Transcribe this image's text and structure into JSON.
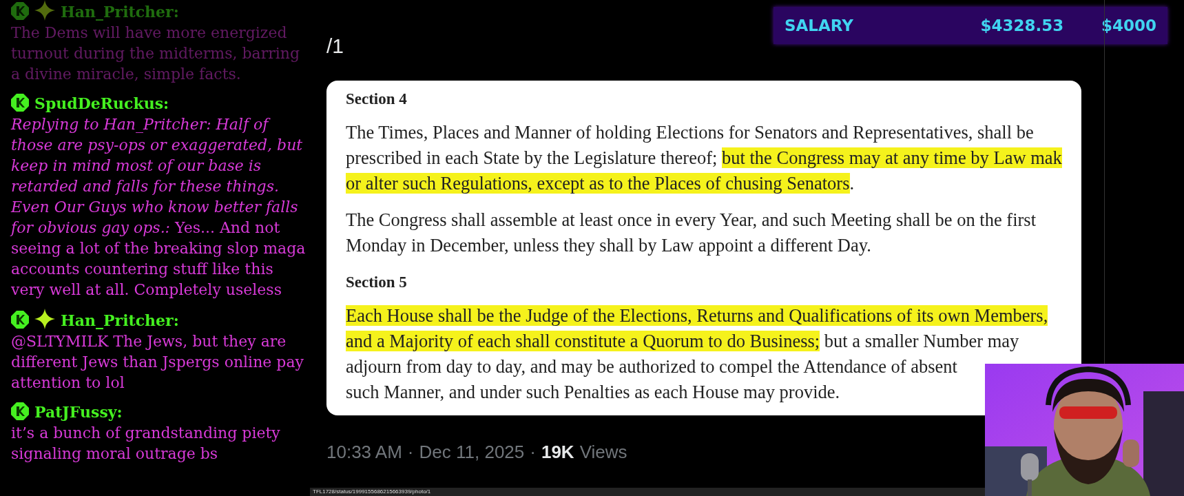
{
  "chat": {
    "messages": [
      {
        "faded": true,
        "sparkle": true,
        "user": "Han_Pritcher:",
        "text": "The Dems will have more energized turnout during the midterms, barring a divine miracle, simple facts."
      },
      {
        "faded": false,
        "sparkle": false,
        "user": "SpudDeRuckus:",
        "text": "*Replying to Han_Pritcher: Half of those are psy-ops or exaggerated, but keep in mind most of our base is retarded and falls for these things. Even Our Guys who know better falls for obvious gay ops.:* Yes... And not seeing a lot of the breaking slop maga accounts countering stuff like this very well at all. Completely useless"
      },
      {
        "faded": false,
        "sparkle": true,
        "user": "Han_Pritcher:",
        "text": "@SLTYMILK The Jews, but they are different Jews than Jspergs online pay attention to lol"
      },
      {
        "faded": false,
        "sparkle": false,
        "user": "PatJFussy:",
        "text": "it’s a bunch of grandstanding piety signaling moral outrage bs"
      }
    ]
  },
  "salary": {
    "label": "SALARY",
    "value": "$4328.53",
    "goal": "$4000"
  },
  "photo_counter": "/1",
  "document": {
    "blocks": [
      {
        "kind": "heading",
        "text": "Section 4"
      },
      {
        "kind": "paragraph",
        "lines": [
          [
            {
              "text": "The Times, Places and Manner of holding Elections for Senators and Representatives, shall be",
              "highlighted": false
            }
          ],
          [
            {
              "text": "prescribed in each State by the Legislature thereof; ",
              "highlighted": false
            },
            {
              "text": "but the Congress may at any time by Law mak",
              "highlighted": true
            }
          ],
          [
            {
              "text": "or alter such Regulations, except as to the Places of chusing Senators",
              "highlighted": true
            },
            {
              "text": ".",
              "highlighted": false
            }
          ]
        ]
      },
      {
        "kind": "paragraph",
        "lines": [
          [
            {
              "text": "The Congress shall assemble at least once in every Year, and such Meeting shall be on the first",
              "highlighted": false
            }
          ],
          [
            {
              "text": "Monday in December, unless they shall by Law appoint a different Day.",
              "highlighted": false
            }
          ]
        ]
      },
      {
        "kind": "heading",
        "text": "Section 5"
      },
      {
        "kind": "paragraph",
        "lines": [
          [
            {
              "text": "Each House shall be the Judge of the Elections, Returns and Qualifications of its own Members,",
              "highlighted": true
            }
          ],
          [
            {
              "text": "and a Majority of each shall constitute a Quorum to do Business;",
              "highlighted": true
            },
            {
              "text": " but a smaller Number may",
              "highlighted": false
            }
          ],
          [
            {
              "text": "adjourn from day to day, and may be authorized to compel the Attendance of absent",
              "highlighted": false
            }
          ],
          [
            {
              "text": "such Manner, and under such Penalties as each House may provide.",
              "highlighted": false
            }
          ]
        ]
      }
    ]
  },
  "post_meta": {
    "time": "10:33 AM",
    "date": "Dec 11, 2025",
    "views_count": "19K",
    "views_label": "Views",
    "separator": "·"
  },
  "status_url": "TFL1728/status/1999155686215663939/photo/1"
}
